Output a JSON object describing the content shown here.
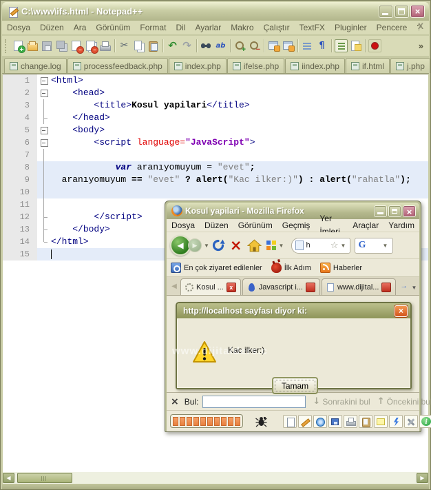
{
  "notepadpp": {
    "title": "C:\\www\\ifs.html - Notepad++",
    "menu": [
      "Dosya",
      "Düzen",
      "Ara",
      "Görünüm",
      "Format",
      "Dil",
      "Ayarlar",
      "Makro",
      "Çalıştır",
      "TextFX",
      "Pluginler",
      "Pencere",
      "?"
    ],
    "menu_close": "X",
    "overflow_chevron": "»",
    "toolbar": [
      {
        "name": "new-file-icon",
        "cls": "tb-new",
        "inter": "true"
      },
      {
        "name": "open-file-icon",
        "cls": "tb-open",
        "inter": "true"
      },
      {
        "name": "save-icon",
        "cls": "tb-save",
        "inter": "true"
      },
      {
        "name": "save-all-icon",
        "cls": "tb-saveall",
        "inter": "true"
      },
      {
        "name": "close-file-icon",
        "cls": "tb-closef",
        "inter": "true"
      },
      {
        "name": "close-all-icon",
        "cls": "tb-closeall",
        "inter": "true"
      },
      {
        "name": "print-icon",
        "cls": "tb-print",
        "inter": "true"
      },
      {
        "name": "toolbar-separator",
        "cls": "tbsep",
        "inter": "false"
      },
      {
        "name": "cut-icon",
        "cls": "tb-cut",
        "glyph": "✂",
        "inter": "true"
      },
      {
        "name": "copy-icon",
        "cls": "tb-copy",
        "inter": "true"
      },
      {
        "name": "paste-icon",
        "cls": "tb-paste",
        "inter": "true"
      },
      {
        "name": "toolbar-separator",
        "cls": "tbsep",
        "inter": "false"
      },
      {
        "name": "undo-icon",
        "cls": "tb-undo",
        "glyph": "↶",
        "inter": "true"
      },
      {
        "name": "redo-icon",
        "cls": "tb-redo",
        "glyph": "↷",
        "inter": "true"
      },
      {
        "name": "toolbar-separator",
        "cls": "tbsep",
        "inter": "false"
      },
      {
        "name": "find-icon",
        "cls": "tb-find",
        "inter": "true"
      },
      {
        "name": "replace-icon",
        "cls": "tb-replace",
        "glyph": "ab",
        "inter": "true"
      },
      {
        "name": "toolbar-separator",
        "cls": "tbsep",
        "inter": "false"
      },
      {
        "name": "zoom-in-icon",
        "cls": "tb-zoomin",
        "inter": "true"
      },
      {
        "name": "zoom-out-icon",
        "cls": "tb-zoomout",
        "inter": "true"
      },
      {
        "name": "toolbar-separator",
        "cls": "tbsep",
        "inter": "false"
      },
      {
        "name": "sync-vertical-icon",
        "cls": "tb-sync1",
        "inter": "true"
      },
      {
        "name": "sync-horizontal-icon",
        "cls": "tb-sync2",
        "inter": "true"
      },
      {
        "name": "toolbar-separator",
        "cls": "tbsep",
        "inter": "false"
      },
      {
        "name": "word-wrap-icon",
        "cls": "tb-wrap",
        "inter": "true"
      },
      {
        "name": "show-symbols-icon",
        "cls": "tb-pilcrow",
        "glyph": "¶",
        "inter": "true"
      },
      {
        "name": "toolbar-separator",
        "cls": "tbsep",
        "inter": "false"
      },
      {
        "name": "doc-switcher-icon",
        "cls": "tb-list",
        "inter": "true"
      },
      {
        "name": "doc-map-icon",
        "cls": "tb-map",
        "inter": "true"
      },
      {
        "name": "toolbar-separator",
        "cls": "tbsep",
        "inter": "false"
      },
      {
        "name": "record-macro-icon",
        "cls": "tb-record",
        "inter": "true"
      }
    ],
    "tabs": [
      {
        "label": "change.log"
      },
      {
        "label": "processfeedback.php"
      },
      {
        "label": "index.php"
      },
      {
        "label": "ifelse.php"
      },
      {
        "label": "iindex.php"
      },
      {
        "label": "if.html"
      },
      {
        "label": "j.php"
      }
    ],
    "tab_scroll_left": "◀",
    "tab_scroll_right": "▶",
    "hscroll_left": "◀",
    "hscroll_right": "▶",
    "editor": {
      "lines": [
        {
          "n": "1",
          "fold": "fm-box",
          "tokens": [
            {
              "t": "<html>",
              "c": "tk-tag"
            }
          ]
        },
        {
          "n": "2",
          "fold": "fm-box",
          "tokens": [
            {
              "t": "    ",
              "c": ""
            },
            {
              "t": "<head>",
              "c": "tk-tag"
            }
          ]
        },
        {
          "n": "3",
          "fold": "fm-line",
          "tokens": [
            {
              "t": "        ",
              "c": ""
            },
            {
              "t": "<title>",
              "c": "tk-tag"
            },
            {
              "t": "Kosul yapilari",
              "c": "tk-b"
            },
            {
              "t": "</title>",
              "c": "tk-tag"
            }
          ]
        },
        {
          "n": "4",
          "fold": "fm-tick",
          "tokens": [
            {
              "t": "    ",
              "c": ""
            },
            {
              "t": "</head>",
              "c": "tk-tag"
            }
          ]
        },
        {
          "n": "5",
          "fold": "fm-box",
          "tokens": [
            {
              "t": "    ",
              "c": ""
            },
            {
              "t": "<body>",
              "c": "tk-tag"
            }
          ]
        },
        {
          "n": "6",
          "fold": "fm-box",
          "tokens": [
            {
              "t": "        ",
              "c": ""
            },
            {
              "t": "<script ",
              "c": "tk-tag"
            },
            {
              "t": "language",
              "c": "tk-attr"
            },
            {
              "t": "=",
              "c": "tk-attr"
            },
            {
              "t": "\"JavaScript\"",
              "c": "tk-val"
            },
            {
              "t": ">",
              "c": "tk-tag"
            }
          ]
        },
        {
          "n": "7",
          "fold": "fm-line",
          "tokens": []
        },
        {
          "n": "8",
          "fold": "fm-line",
          "hlc": "hl",
          "tokens": [
            {
              "t": "            ",
              "c": ""
            },
            {
              "t": "var",
              "c": "tk-kw"
            },
            {
              "t": " aranıyomuyum = ",
              "c": ""
            },
            {
              "t": "\"evet\"",
              "c": "tk-str"
            },
            {
              "t": ";",
              "c": "tk-op"
            }
          ]
        },
        {
          "n": "9",
          "fold": "fm-line",
          "hlc": "hl",
          "tokens": [
            {
              "t": "  aranıyomuyum ",
              "c": ""
            },
            {
              "t": "== ",
              "c": "tk-op"
            },
            {
              "t": "\"evet\"",
              "c": "tk-str"
            },
            {
              "t": " ? ",
              "c": "tk-op"
            },
            {
              "t": "alert(",
              "c": "tk-op"
            },
            {
              "t": "\"Kac ilker:)\"",
              "c": "tk-str"
            },
            {
              "t": ") : ",
              "c": "tk-op"
            },
            {
              "t": "alert(",
              "c": "tk-op"
            },
            {
              "t": "\"rahatla\"",
              "c": "tk-str"
            },
            {
              "t": ");",
              "c": "tk-op"
            }
          ]
        },
        {
          "n": "10",
          "fold": "fm-line",
          "hlc": "hl",
          "tokens": []
        },
        {
          "n": "11",
          "fold": "fm-line",
          "tokens": []
        },
        {
          "n": "12",
          "fold": "fm-tick",
          "tokens": [
            {
              "t": "        ",
              "c": ""
            },
            {
              "t": "</script>",
              "c": "tk-tag"
            }
          ]
        },
        {
          "n": "13",
          "fold": "fm-tick",
          "tokens": [
            {
              "t": "    ",
              "c": ""
            },
            {
              "t": "</body>",
              "c": "tk-tag"
            }
          ]
        },
        {
          "n": "14",
          "fold": "fm-end",
          "tokens": [
            {
              "t": "</html>",
              "c": "tk-tag"
            }
          ]
        },
        {
          "n": "15",
          "fold": "",
          "hlc": "hl",
          "caret": "show",
          "tokens": []
        }
      ]
    }
  },
  "firefox": {
    "title": "Kosul yapilari - Mozilla Firefox",
    "menu": [
      "Dosya",
      "Düzen",
      "Görünüm",
      "Geçmiş",
      "Yer İmleri",
      "Araçlar",
      "Yardım"
    ],
    "nav": {
      "back": "◀",
      "forward": "▶",
      "stop": "×",
      "url_text": "h",
      "star": "☆",
      "g_logo": "G"
    },
    "bookmarks": [
      {
        "label": "En çok ziyaret edilenler",
        "cls": "bm-search",
        "name": "most-visited-icon"
      },
      {
        "label": "İlk Adım",
        "cls": "bm-devil",
        "name": "ilk-adim-icon"
      },
      {
        "label": "Haberler",
        "cls": "bm-rss",
        "name": "rss-news-icon"
      }
    ],
    "tabs": [
      {
        "label": "Kosul ...",
        "icon": "tabic-spinner",
        "state": "active",
        "close": "x"
      },
      {
        "label": "Javascript i...",
        "icon": "tabic-js",
        "state": "",
        "close": null
      },
      {
        "label": "www.dijital...",
        "icon": "tabic-page",
        "state": "",
        "close": null
      }
    ],
    "tab_left_arrow": "◀",
    "tab_right_arrow": "→",
    "dialog": {
      "title": "http://localhost sayfası diyor ki:",
      "message": "Kac ilker:)",
      "ok": "Tamam",
      "close": "×"
    },
    "findbar": {
      "close": "×",
      "label": "Bul:",
      "next_arrow": "↓",
      "next": "Sonrakini bul",
      "prev_arrow": "↑",
      "prev": "Öncekini bul"
    },
    "statusbar": {
      "blocks": [
        "",
        "",
        "",
        "",
        "",
        "",
        "",
        "",
        "",
        ""
      ],
      "buttons": [
        {
          "name": "new-page-icon",
          "cls": "sb-doc"
        },
        {
          "name": "edit-pencil-icon",
          "cls": "sb-pencil"
        },
        {
          "name": "globe-icon",
          "cls": "sb-globe"
        },
        {
          "name": "save-icon",
          "cls": "sb-save"
        },
        {
          "name": "print-icon",
          "cls": "sb-print"
        },
        {
          "name": "clipboard-icon",
          "cls": "sb-clip"
        },
        {
          "name": "note-icon",
          "cls": "sb-note"
        },
        {
          "name": "lightning-icon",
          "cls": "sb-bolt"
        },
        {
          "name": "tools-icon",
          "cls": "sb-tools"
        },
        {
          "name": "info-icon",
          "cls": "sb-info"
        }
      ]
    },
    "watermark": "www.dijitalders.c"
  }
}
